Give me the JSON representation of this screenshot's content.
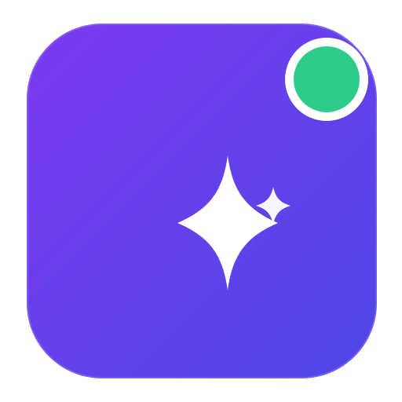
{
  "app_icon": {
    "icon": "sparkle-icon",
    "gradient": {
      "start": "#7a3af0",
      "end": "#4f46e5"
    },
    "sparkle_color": "#ffffff"
  },
  "status_indicator": {
    "color": "#2ecc8a",
    "ring_color": "#ffffff"
  }
}
